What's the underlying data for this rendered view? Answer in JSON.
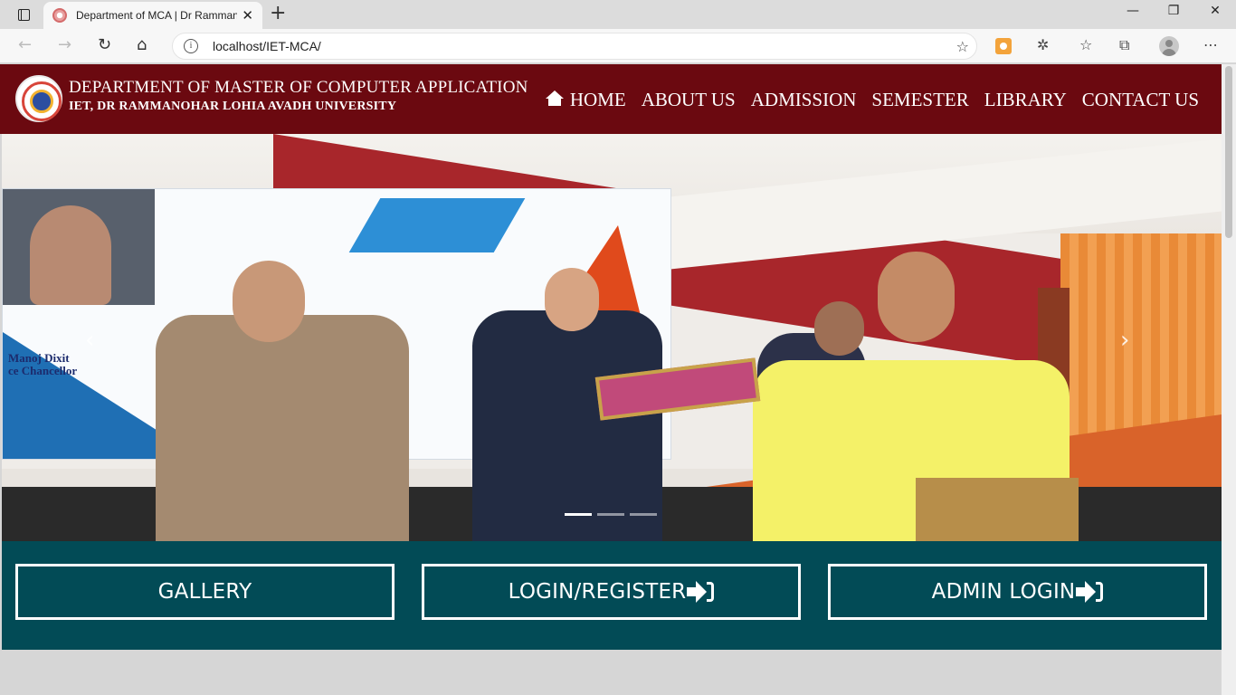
{
  "browser": {
    "tab_title": "Department of MCA | Dr Rammanohar Lohia Avadh University",
    "tab_close": "✕",
    "new_tab": "+",
    "window_minimize": "—",
    "window_maximize": "❐",
    "window_close": "✕",
    "url": "localhost/IET-MCA/",
    "nav_icons": {
      "back": "arrow-left-icon",
      "forward": "arrow-right-icon",
      "reload": "reload-icon",
      "home": "home-icon"
    },
    "toolbar_icons": [
      "add-favorite-icon",
      "extension-icon",
      "puzzle-icon",
      "favorites-icon",
      "collections-icon",
      "profile-icon",
      "more-icon"
    ]
  },
  "header": {
    "title": "DEPARTMENT OF MASTER OF COMPUTER APPLICATION",
    "subtitle": "IET, DR RAMMANOHAR LOHIA AVADH UNIVERSITY",
    "nav": [
      {
        "label": "HOME",
        "icon": "home-icon"
      },
      {
        "label": "ABOUT US"
      },
      {
        "label": "ADMISSION"
      },
      {
        "label": "SEMESTER"
      },
      {
        "label": "LIBRARY"
      },
      {
        "label": "CONTACT US"
      }
    ]
  },
  "slider": {
    "banner_text": [
      "Manoj Dixit",
      "ce Chancellor"
    ],
    "prev": "‹",
    "next": "›",
    "indicators": 3,
    "active_indicator": 0
  },
  "actions": {
    "gallery": "GALLERY",
    "login_register": "LOGIN/REGISTER",
    "admin_login": "ADMIN LOGIN"
  },
  "colors": {
    "header_bg": "#6b0910",
    "action_bar_bg": "#024b56",
    "page_bg": "#d6d6d6"
  }
}
